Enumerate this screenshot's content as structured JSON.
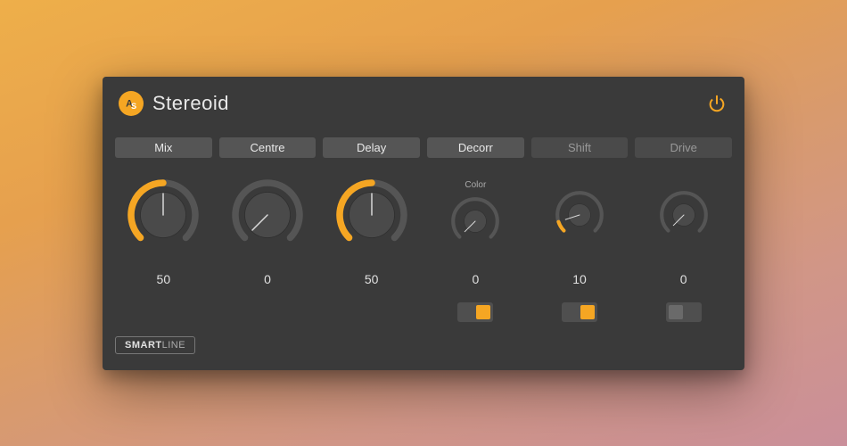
{
  "header": {
    "logo_letters": "AS",
    "title": "Stereoid"
  },
  "accent_color": "#f5a623",
  "controls": [
    {
      "label": "Mix",
      "active": true,
      "size": "big",
      "value": 50,
      "value_text": "50",
      "sublabel": null,
      "has_toggle": false,
      "toggle_on": false
    },
    {
      "label": "Centre",
      "active": true,
      "size": "big",
      "value": 0,
      "value_text": "0",
      "sublabel": null,
      "has_toggle": false,
      "toggle_on": false
    },
    {
      "label": "Delay",
      "active": true,
      "size": "big",
      "value": 50,
      "value_text": "50",
      "sublabel": null,
      "has_toggle": false,
      "toggle_on": false
    },
    {
      "label": "Decorr",
      "active": true,
      "size": "small",
      "value": 0,
      "value_text": "0",
      "sublabel": "Color",
      "has_toggle": true,
      "toggle_on": true
    },
    {
      "label": "Shift",
      "active": false,
      "size": "small",
      "value": 10,
      "value_text": "10",
      "sublabel": null,
      "has_toggle": true,
      "toggle_on": true
    },
    {
      "label": "Drive",
      "active": false,
      "size": "small",
      "value": 0,
      "value_text": "0",
      "sublabel": null,
      "has_toggle": true,
      "toggle_on": false
    }
  ],
  "footer": {
    "brand_bold": "SMART",
    "brand_light": "LINE"
  }
}
